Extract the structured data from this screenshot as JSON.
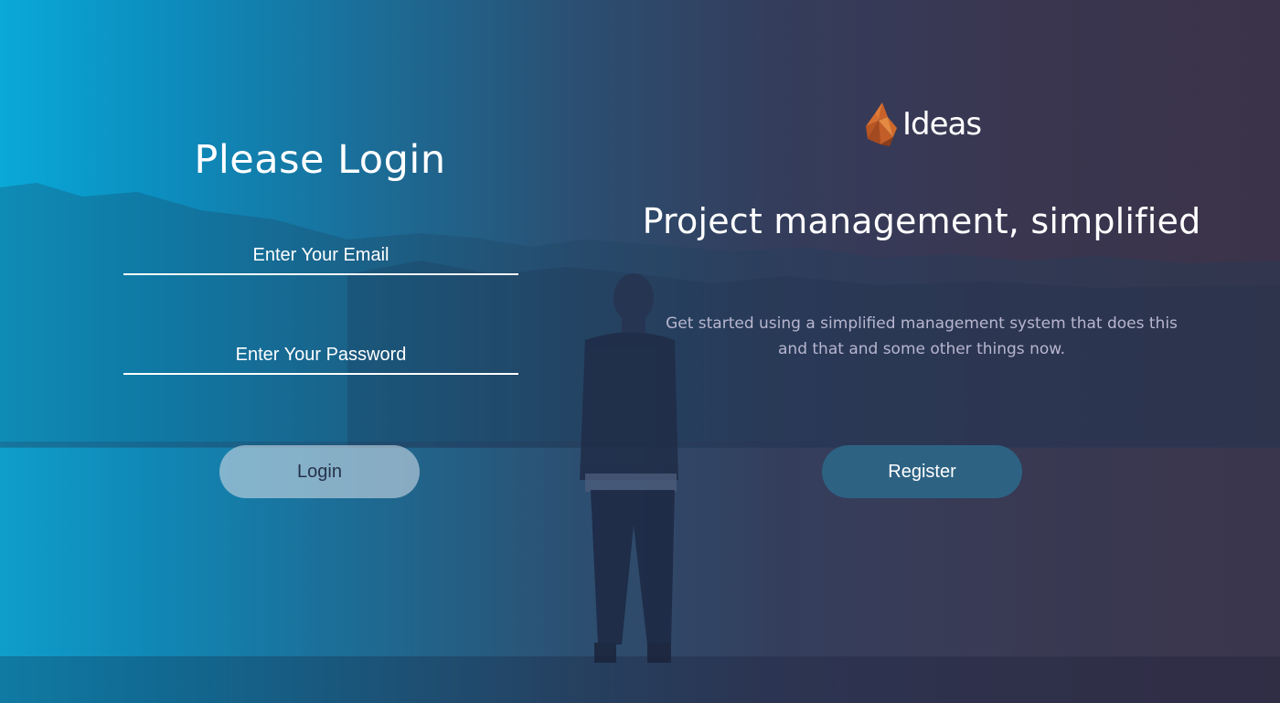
{
  "login": {
    "title": "Please Login",
    "email_placeholder": "Enter Your Email",
    "email_value": "",
    "password_placeholder": "Enter Your Password",
    "password_value": "",
    "login_label": "Login"
  },
  "brand": {
    "name": "Ideas",
    "logo_icon": "flame-logo-icon",
    "logo_color": "#d0692a"
  },
  "promo": {
    "tagline": "Project management, simplified",
    "description": "Get started using a simplified management system that does this and that and some other things now.",
    "register_label": "Register"
  },
  "colors": {
    "gradient_left": "#0aa9d8",
    "gradient_right": "#3b3349",
    "register_button": "#2d6283",
    "login_button": "#c8d7e4"
  }
}
